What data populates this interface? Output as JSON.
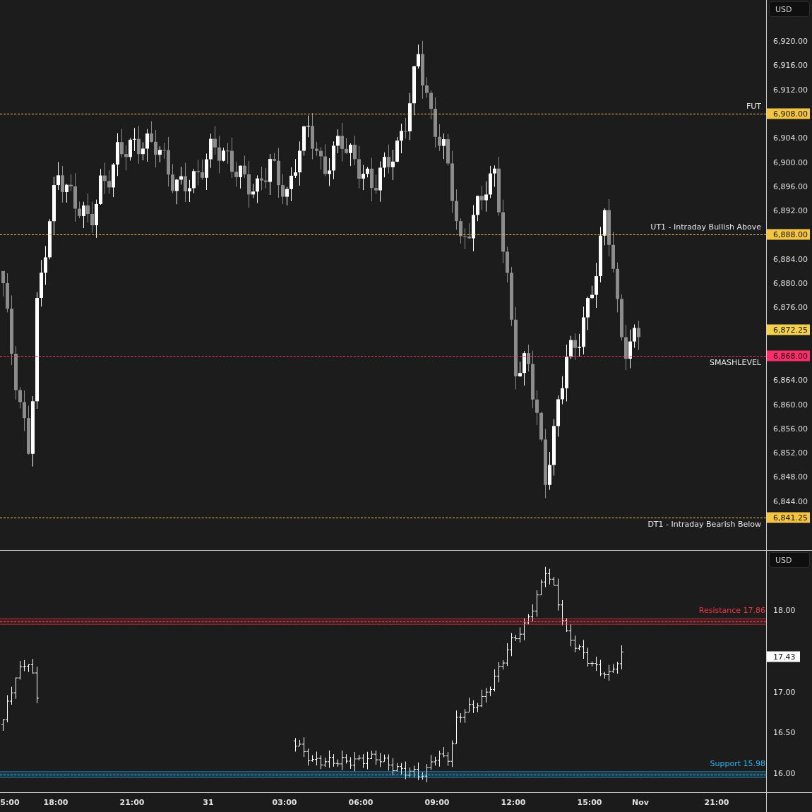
{
  "price_panel": {
    "currency_button": "USD",
    "axis_labels": [
      "6,920.00",
      "6,916.00",
      "6,912.00",
      "6,904.00",
      "6,900.00",
      "6,896.00",
      "6,892.00",
      "6,884.00",
      "6,880.00",
      "6,876.00",
      "6,864.00",
      "6,860.00",
      "6,856.00",
      "6,852.00",
      "6,848.00",
      "6,844.00"
    ],
    "levels": [
      {
        "label": "FUT",
        "price": "6,908.00",
        "color": "#f5c542"
      },
      {
        "label": "UT1 - Intraday Bullish Above",
        "price": "6,888.00",
        "color": "#f5c542"
      },
      {
        "label": "SMASHLEVEL",
        "price": "6,868.00",
        "color": "#ff2d6a"
      },
      {
        "label": "DT1 - Intraday Bearish Below",
        "price": "6,841.25",
        "color": "#f5c542"
      }
    ],
    "last_price": "6,872.25"
  },
  "indicator_panel": {
    "currency_button": "USD",
    "axis_labels": [
      "18.00",
      "17.00",
      "16.50",
      "16.00"
    ],
    "levels": [
      {
        "label": "Resistance 17.86",
        "color": "#f23645"
      },
      {
        "label": "Support 15.98",
        "color": "#29b6f6"
      }
    ],
    "last_value": "17.43"
  },
  "time_axis": [
    "5:00",
    "18:00",
    "21:00",
    "31",
    "03:00",
    "06:00",
    "09:00",
    "12:00",
    "15:00",
    "Nov",
    "21:00"
  ]
}
